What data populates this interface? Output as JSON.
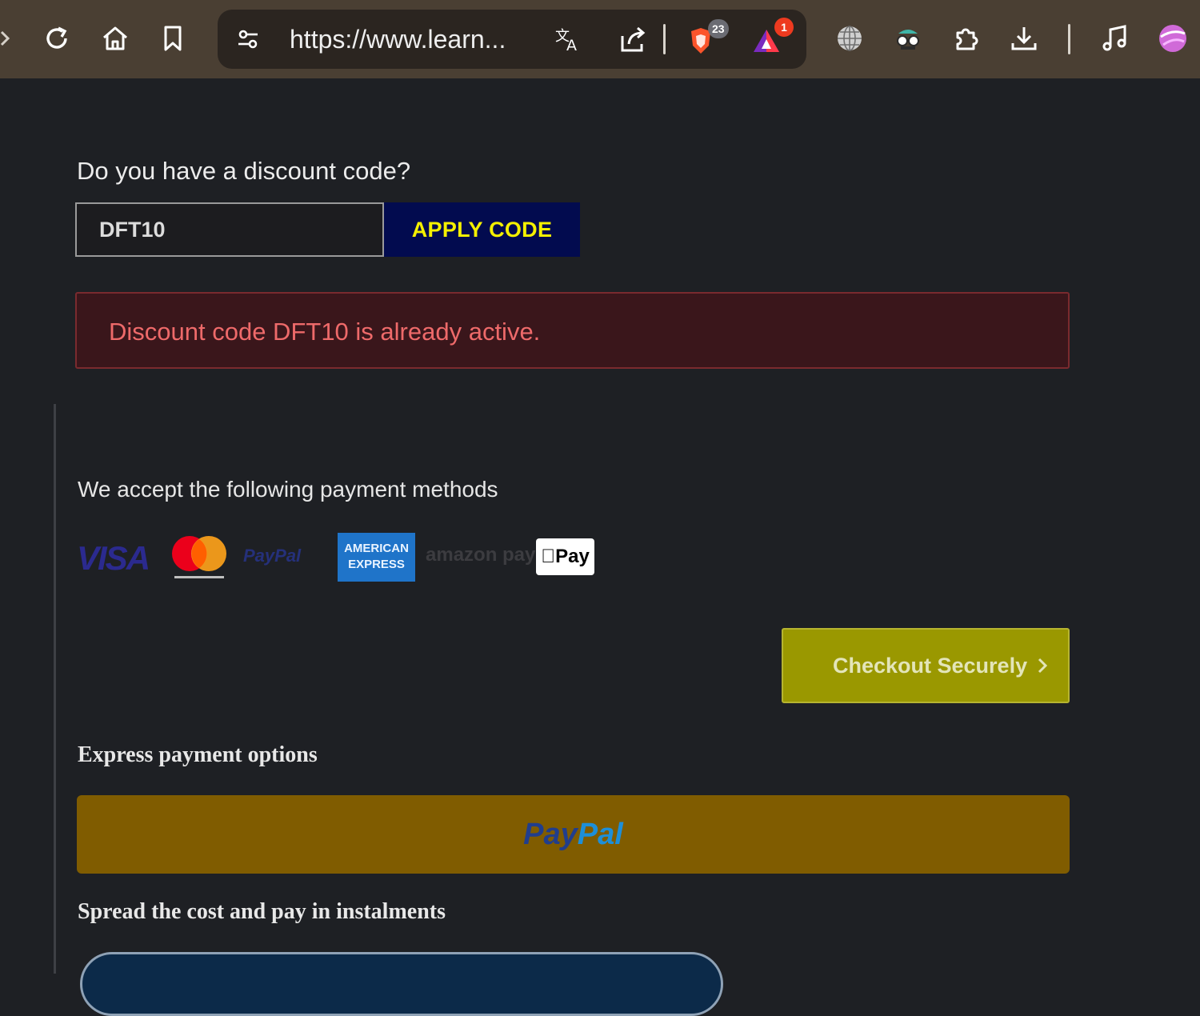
{
  "browser": {
    "url": "https://www.learn...",
    "brave_shield_count": "23",
    "rewards_count": "1"
  },
  "discount": {
    "question": "Do you have a discount code?",
    "code_value": "DFT10",
    "apply_label": "APPLY CODE",
    "alert": "Discount code DFT10 is already active."
  },
  "payment": {
    "methods_heading": "We accept the following payment methods",
    "logos": {
      "visa": "VISA",
      "paypal": "PayPal",
      "amex_line1": "AMERICAN",
      "amex_line2": "EXPRESS",
      "amazon": "amazon pay",
      "applepay": "Pay"
    },
    "checkout_label": "Checkout Securely",
    "express_heading": "Express payment options",
    "paypal_button_pay": "Pay",
    "paypal_button_pal": "Pal",
    "instalments_heading": "Spread the cost and pay in instalments"
  },
  "colors": {
    "toolbar": "#4a3f33",
    "page_bg": "#1e2024",
    "apply_bg": "#020b4f",
    "apply_text": "#f4f000",
    "alert_bg": "#3a161b",
    "alert_text": "#ee6a6a",
    "checkout_bg": "#9a9800",
    "paypal_bg": "#805c00"
  },
  "icons": [
    "back-icon",
    "reload-icon",
    "home-icon",
    "bookmark-icon",
    "site-settings-icon",
    "translate-icon",
    "share-icon",
    "brave-shield-icon",
    "brave-rewards-icon",
    "globe-icon",
    "spy-glasses-icon",
    "extensions-icon",
    "download-icon",
    "music-icon",
    "profile-avatar-icon",
    "chevron-right-icon"
  ]
}
